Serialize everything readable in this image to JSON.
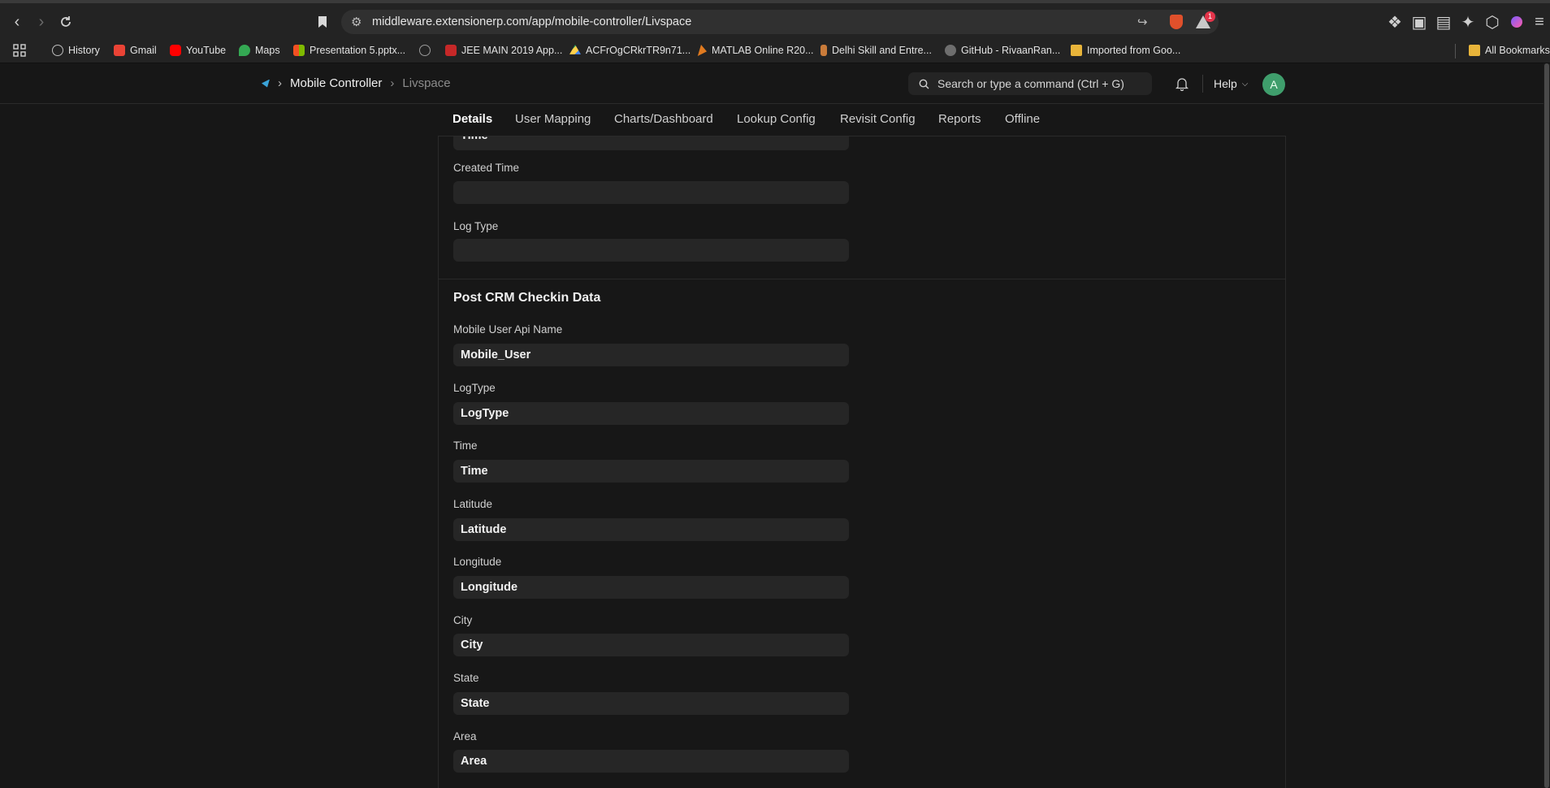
{
  "browser": {
    "url": "middleware.extensionerp.com/app/mobile-controller/Livspace",
    "notification_count": "1",
    "bookmarks": [
      {
        "label": "History",
        "color": "#9a9a9a"
      },
      {
        "label": "Gmail",
        "color": "#ea4335"
      },
      {
        "label": "YouTube",
        "color": "#ff0000"
      },
      {
        "label": "Maps",
        "color": "#34a853"
      },
      {
        "label": "Presentation 5.pptx...",
        "color": "#d24726"
      },
      {
        "label": "",
        "color": "#8a8a8a"
      },
      {
        "label": "JEE MAIN 2019 App...",
        "color": "#c62828"
      },
      {
        "label": "ACFrOgCRkrTR9n71...",
        "color": "#1fa463"
      },
      {
        "label": "MATLAB Online R20...",
        "color": "#e07a1f"
      },
      {
        "label": "Delhi Skill and Entre...",
        "color": "#c97b3a"
      },
      {
        "label": "GitHub - RivaanRan...",
        "color": "#6e6e6e"
      },
      {
        "label": "Imported from Goo...",
        "color": "#e8b43a"
      }
    ],
    "all_bookmarks": "All Bookmarks"
  },
  "app": {
    "breadcrumb": [
      "Mobile Controller",
      "Livspace"
    ],
    "search_placeholder": "Search or type a command (Ctrl + G)",
    "help_label": "Help",
    "avatar_initial": "A"
  },
  "tabs": [
    {
      "label": "Details",
      "active": true
    },
    {
      "label": "User Mapping",
      "active": false
    },
    {
      "label": "Charts/Dashboard",
      "active": false
    },
    {
      "label": "Lookup Config",
      "active": false
    },
    {
      "label": "Revisit Config",
      "active": false
    },
    {
      "label": "Reports",
      "active": false
    },
    {
      "label": "Offline",
      "active": false
    }
  ],
  "top_fields": [
    {
      "label": "",
      "value": "Time"
    },
    {
      "label": "Created Time",
      "value": ""
    },
    {
      "label": "Log Type",
      "value": ""
    }
  ],
  "section": {
    "title": "Post CRM Checkin Data",
    "fields": [
      {
        "label": "Mobile User Api Name",
        "value": "Mobile_User"
      },
      {
        "label": "LogType",
        "value": "LogType"
      },
      {
        "label": "Time",
        "value": "Time"
      },
      {
        "label": "Latitude",
        "value": "Latitude"
      },
      {
        "label": "Longitude",
        "value": "Longitude"
      },
      {
        "label": "City",
        "value": "City"
      },
      {
        "label": "State",
        "value": "State"
      },
      {
        "label": "Area",
        "value": "Area"
      }
    ]
  }
}
